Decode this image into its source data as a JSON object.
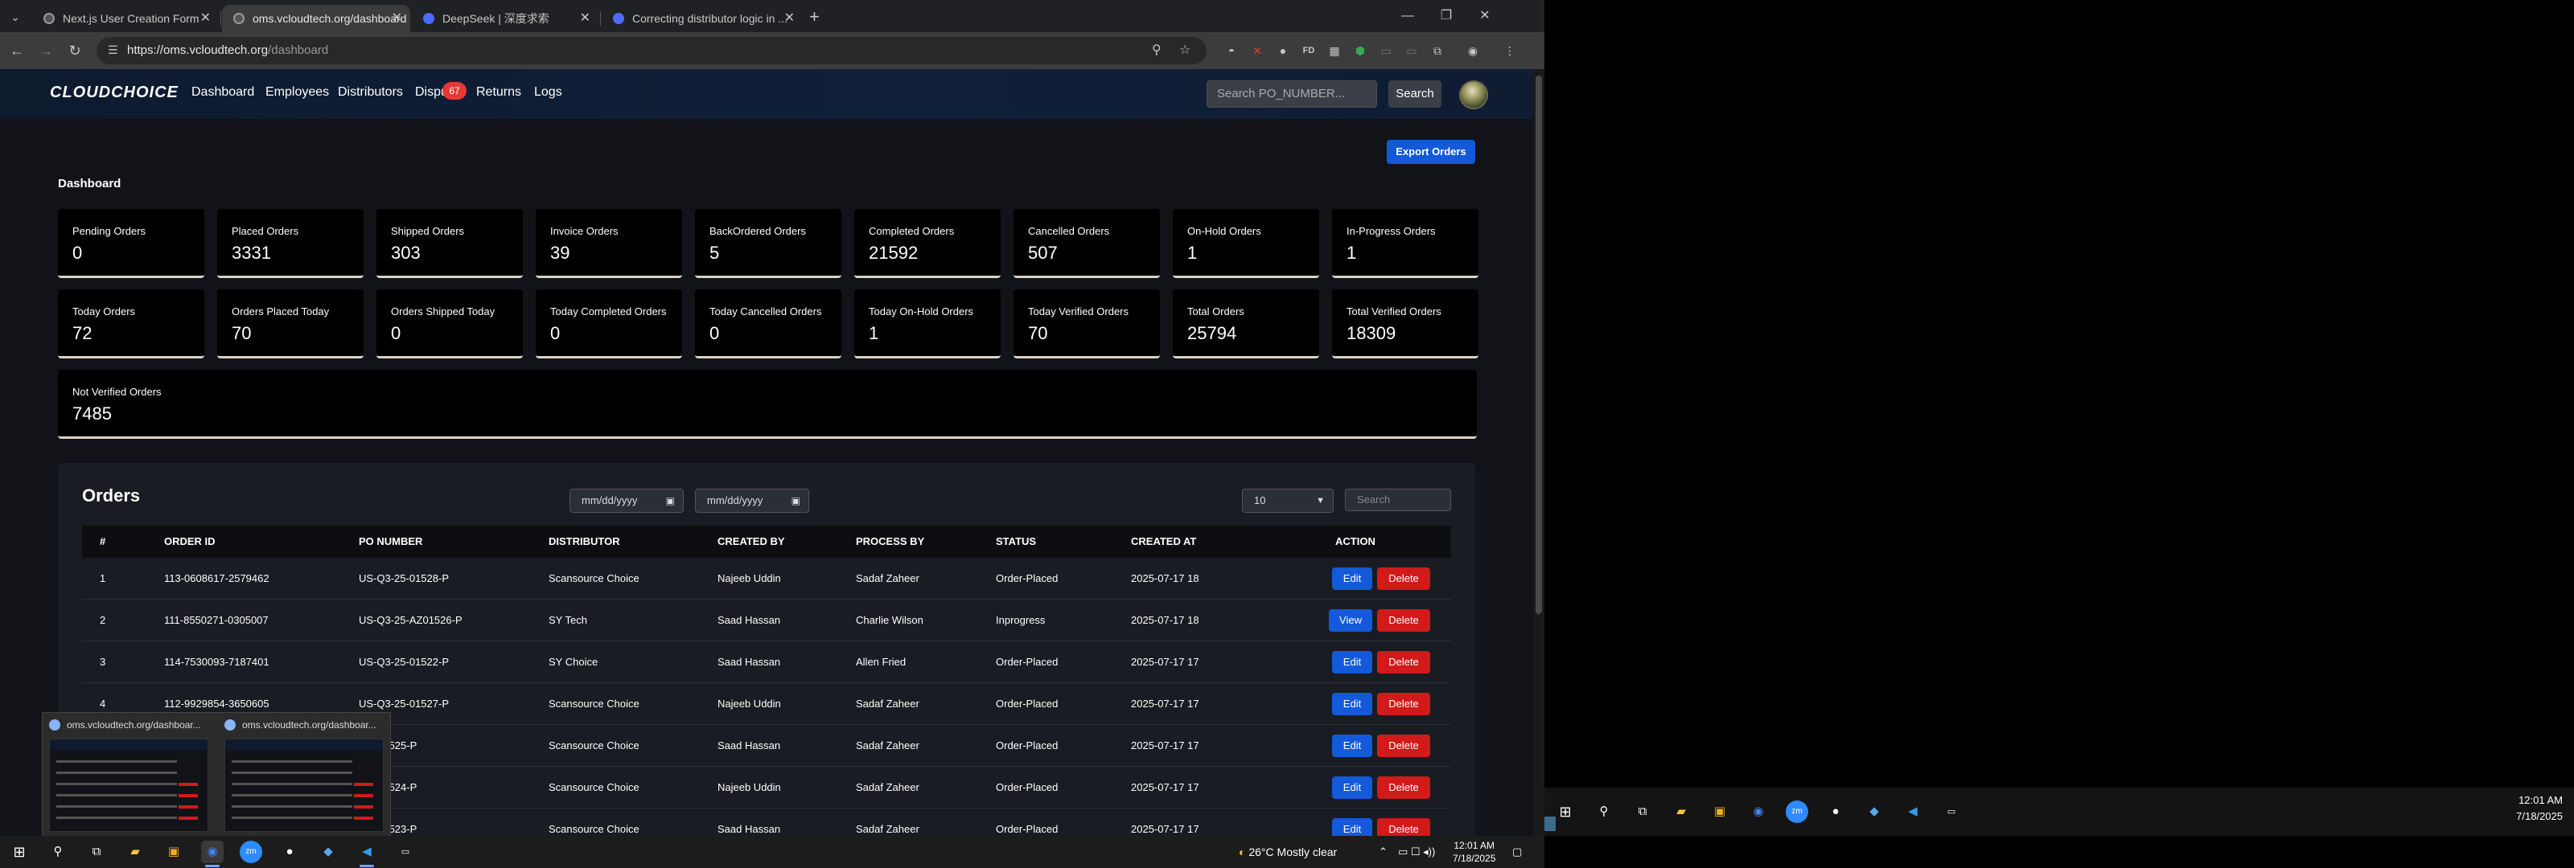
{
  "browser": {
    "tabs": [
      {
        "title": "Next.js User Creation Form",
        "active": false
      },
      {
        "title": "oms.vcloudtech.org/dashboard",
        "active": true
      },
      {
        "title": "DeepSeek | 深度求索",
        "active": false
      },
      {
        "title": "Correcting distributor logic in ...",
        "active": false
      }
    ],
    "url_host": "https://oms.vcloudtech.org",
    "url_path": "/dashboard"
  },
  "app": {
    "logo": "CLOUDCHOICE",
    "nav": [
      "Dashboard",
      "Employees",
      "Distributors",
      "Dispu",
      "Returns",
      "Logs"
    ],
    "disputes_badge": "67",
    "search_placeholder": "Search PO_NUMBER...",
    "search_button": "Search"
  },
  "dashboard": {
    "export_button": "Export Orders",
    "title": "Dashboard",
    "stats_row1": [
      {
        "label": "Pending Orders",
        "value": "0"
      },
      {
        "label": "Placed Orders",
        "value": "3331"
      },
      {
        "label": "Shipped Orders",
        "value": "303"
      },
      {
        "label": "Invoice Orders",
        "value": "39"
      },
      {
        "label": "BackOrdered Orders",
        "value": "5"
      },
      {
        "label": "Completed Orders",
        "value": "21592"
      },
      {
        "label": "Cancelled Orders",
        "value": "507"
      },
      {
        "label": "On-Hold Orders",
        "value": "1"
      },
      {
        "label": "In-Progress Orders",
        "value": "1"
      }
    ],
    "stats_row2": [
      {
        "label": "Today Orders",
        "value": "72"
      },
      {
        "label": "Orders Placed Today",
        "value": "70"
      },
      {
        "label": "Orders Shipped Today",
        "value": "0"
      },
      {
        "label": "Today Completed Orders",
        "value": "0"
      },
      {
        "label": "Today Cancelled Orders",
        "value": "0"
      },
      {
        "label": "Today On-Hold Orders",
        "value": "1"
      },
      {
        "label": "Today Verified Orders",
        "value": "70"
      },
      {
        "label": "Total Orders",
        "value": "25794"
      },
      {
        "label": "Total Verified Orders",
        "value": "18309"
      }
    ],
    "stats_row3": [
      {
        "label": "Not Verified Orders",
        "value": "7485"
      }
    ]
  },
  "orders": {
    "title": "Orders",
    "date_from_placeholder": "mm/dd/yyyy",
    "date_to_placeholder": "mm/dd/yyyy",
    "rows_per_page": "10",
    "search_placeholder": "Search",
    "columns": [
      "#",
      "ORDER ID",
      "PO NUMBER",
      "DISTRIBUTOR",
      "CREATED BY",
      "PROCESS BY",
      "STATUS",
      "CREATED AT",
      "ACTION"
    ],
    "rows": [
      {
        "n": "1",
        "order_id": "113-0608617-2579462",
        "po": "US-Q3-25-01528-P",
        "distributor": "Scansource Choice",
        "created_by": "Najeeb Uddin",
        "process_by": "Sadaf Zaheer",
        "status": "Order-Placed",
        "created_at": "2025-07-17 18",
        "primary": "Edit",
        "secondary": "Delete"
      },
      {
        "n": "2",
        "order_id": "111-8550271-0305007",
        "po": "US-Q3-25-AZ01526-P",
        "distributor": "SY Tech",
        "created_by": "Saad Hassan",
        "process_by": "Charlie Wilson",
        "status": "Inprogress",
        "created_at": "2025-07-17 18",
        "primary": "View",
        "secondary": "Delete"
      },
      {
        "n": "3",
        "order_id": "114-7530093-7187401",
        "po": "US-Q3-25-01522-P",
        "distributor": "SY Choice",
        "created_by": "Saad Hassan",
        "process_by": "Allen Fried",
        "status": "Order-Placed",
        "created_at": "2025-07-17 17",
        "primary": "Edit",
        "secondary": "Delete"
      },
      {
        "n": "4",
        "order_id": "112-9929854-3650605",
        "po": "US-Q3-25-01527-P",
        "distributor": "Scansource Choice",
        "created_by": "Najeeb Uddin",
        "process_by": "Sadaf Zaheer",
        "status": "Order-Placed",
        "created_at": "2025-07-17 17",
        "primary": "Edit",
        "secondary": "Delete"
      },
      {
        "n": "",
        "order_id": "",
        "po": "-25-01525-P",
        "distributor": "Scansource Choice",
        "created_by": "Saad Hassan",
        "process_by": "Sadaf Zaheer",
        "status": "Order-Placed",
        "created_at": "2025-07-17 17",
        "primary": "Edit",
        "secondary": "Delete"
      },
      {
        "n": "",
        "order_id": "",
        "po": "-25-01524-P",
        "distributor": "Scansource Choice",
        "created_by": "Najeeb Uddin",
        "process_by": "Sadaf Zaheer",
        "status": "Order-Placed",
        "created_at": "2025-07-17 17",
        "primary": "Edit",
        "secondary": "Delete"
      },
      {
        "n": "",
        "order_id": "",
        "po": "-25-01523-P",
        "distributor": "Scansource Choice",
        "created_by": "Saad Hassan",
        "process_by": "Sadaf Zaheer",
        "status": "Order-Placed",
        "created_at": "2025-07-17 17",
        "primary": "Edit",
        "secondary": "Delete"
      }
    ]
  },
  "taskbar_preview": {
    "items": [
      "oms.vcloudtech.org/dashboar...",
      "oms.vcloudtech.org/dashboar..."
    ]
  },
  "taskbar_left": {
    "weather": "26°C  Mostly clear",
    "time": "12:01 AM",
    "date": "7/18/2025"
  },
  "taskbar_right": {
    "time": "12:01 AM",
    "date": "7/18/2025"
  }
}
